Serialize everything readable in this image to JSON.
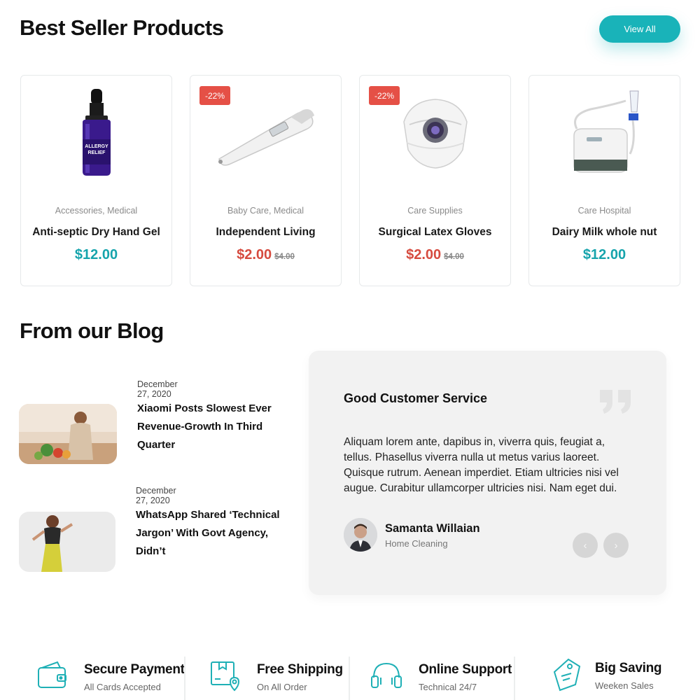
{
  "best_seller": {
    "title": "Best Seller Products",
    "view_all_label": "View All",
    "products": [
      {
        "category": "Accessories, Medical",
        "name": "Anti-septic Dry Hand Gel",
        "price": "$12.00",
        "old_price": "",
        "badge": "",
        "image_icon": "dropper-bottle-icon",
        "image_text": "ALLERGY RELIEF"
      },
      {
        "category": "Baby Care, Medical",
        "name": "Independent Living",
        "price": "$2.00",
        "old_price": "$4.00",
        "badge": "-22%",
        "image_icon": "thermometer-icon"
      },
      {
        "category": "Care Supplies",
        "name": "Surgical Latex Gloves",
        "price": "$2.00",
        "old_price": "$4.00",
        "badge": "-22%",
        "image_icon": "face-mask-icon"
      },
      {
        "category": "Care Hospital",
        "name": "Dairy Milk whole nut",
        "price": "$12.00",
        "old_price": "",
        "badge": "",
        "image_icon": "nebulizer-icon"
      }
    ]
  },
  "blog": {
    "title": "From our Blog",
    "posts": [
      {
        "date": "December 27, 2020",
        "title": "Xiaomi Posts Slowest Ever Revenue-Growth In Third Quarter"
      },
      {
        "date": "December 27, 2020",
        "title": "WhatsApp Shared ‘Technical Jargon’ With Govt Agency, Didn’t"
      }
    ]
  },
  "testimonial": {
    "title": "Good Customer Service",
    "body": "Aliquam lorem ante, dapibus in, viverra quis, feugiat a, tellus. Phasellus viverra nulla ut metus varius laoreet. Quisque rutrum. Aenean imperdiet. Etiam ultricies nisi vel augue. Curabitur ullamcorper ultricies nisi. Nam eget dui.",
    "author_name": "Samanta Willaian",
    "author_role": "Home Cleaning",
    "prev_label": "‹",
    "next_label": "›"
  },
  "features": [
    {
      "title": "Secure Payment",
      "subtitle": "All Cards Accepted",
      "icon": "wallet-icon"
    },
    {
      "title": "Free Shipping",
      "subtitle": "On All Order",
      "icon": "box-location-icon"
    },
    {
      "title": "Online Support",
      "subtitle": "Technical 24/7",
      "icon": "headset-icon"
    },
    {
      "title": "Big Saving",
      "subtitle": "Weeken Sales",
      "icon": "price-tag-icon"
    }
  ],
  "colors": {
    "accent": "#19b3b9",
    "sale": "#e55046",
    "price_teal": "#16a4ac",
    "price_red": "#d64b3f"
  }
}
